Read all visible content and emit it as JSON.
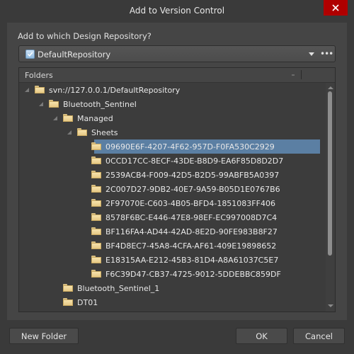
{
  "window": {
    "title": "Add to Version Control",
    "close_icon": "close-x-icon"
  },
  "repository": {
    "prompt": "Add to which Design Repository?",
    "selected": "DefaultRepository",
    "icon": "repository-check-icon",
    "more_label": "•••"
  },
  "tree": {
    "header": "Folders",
    "rows": [
      {
        "label": "svn://127.0.0.1/DefaultRepository",
        "level": 0,
        "expanded": true,
        "selected": false
      },
      {
        "label": "Bluetooth_Sentinel",
        "level": 1,
        "expanded": true,
        "selected": false
      },
      {
        "label": "Managed",
        "level": 2,
        "expanded": true,
        "selected": false
      },
      {
        "label": "Sheets",
        "level": 3,
        "expanded": true,
        "selected": false
      },
      {
        "label": "09690E6F-4207-4F62-957D-F0FA530C2929",
        "level": 4,
        "expanded": false,
        "selected": true
      },
      {
        "label": "0CCD17CC-8ECF-43DE-B8D9-EA6F85D8D2D7",
        "level": 4,
        "expanded": false,
        "selected": false
      },
      {
        "label": "2539ACB4-F009-42D5-B2D5-99ABFB5A0397",
        "level": 4,
        "expanded": false,
        "selected": false
      },
      {
        "label": "2C007D27-9DB2-40E7-9A59-B05D1E0767B6",
        "level": 4,
        "expanded": false,
        "selected": false
      },
      {
        "label": "2F97070E-C603-4B05-BFD4-1851083FF406",
        "level": 4,
        "expanded": false,
        "selected": false
      },
      {
        "label": "8578F6BC-E446-47E8-98EF-EC997008D7C4",
        "level": 4,
        "expanded": false,
        "selected": false
      },
      {
        "label": "BF116FA4-AD44-42AD-8E2D-90FE983B8F27",
        "level": 4,
        "expanded": false,
        "selected": false
      },
      {
        "label": "BF4D8EC7-45A8-4CFA-AF61-409E19898652",
        "level": 4,
        "expanded": false,
        "selected": false
      },
      {
        "label": "E18315AA-E212-45B3-81D4-A8A61037C5E7",
        "level": 4,
        "expanded": false,
        "selected": false
      },
      {
        "label": "F6C39D47-CB37-4725-9012-5DDEBBC859DF",
        "level": 4,
        "expanded": false,
        "selected": false
      },
      {
        "label": "Bluetooth_Sentinel_1",
        "level": 2,
        "expanded": false,
        "selected": false
      },
      {
        "label": "DT01",
        "level": 2,
        "expanded": false,
        "selected": false
      },
      {
        "label": "",
        "level": 2,
        "expanded": false,
        "selected": false
      }
    ]
  },
  "buttons": {
    "new_folder": "New Folder",
    "ok": "OK",
    "cancel": "Cancel"
  },
  "colors": {
    "selection": "#5b7fa3",
    "close_button": "#b00000",
    "background": "#3a3a3a"
  }
}
